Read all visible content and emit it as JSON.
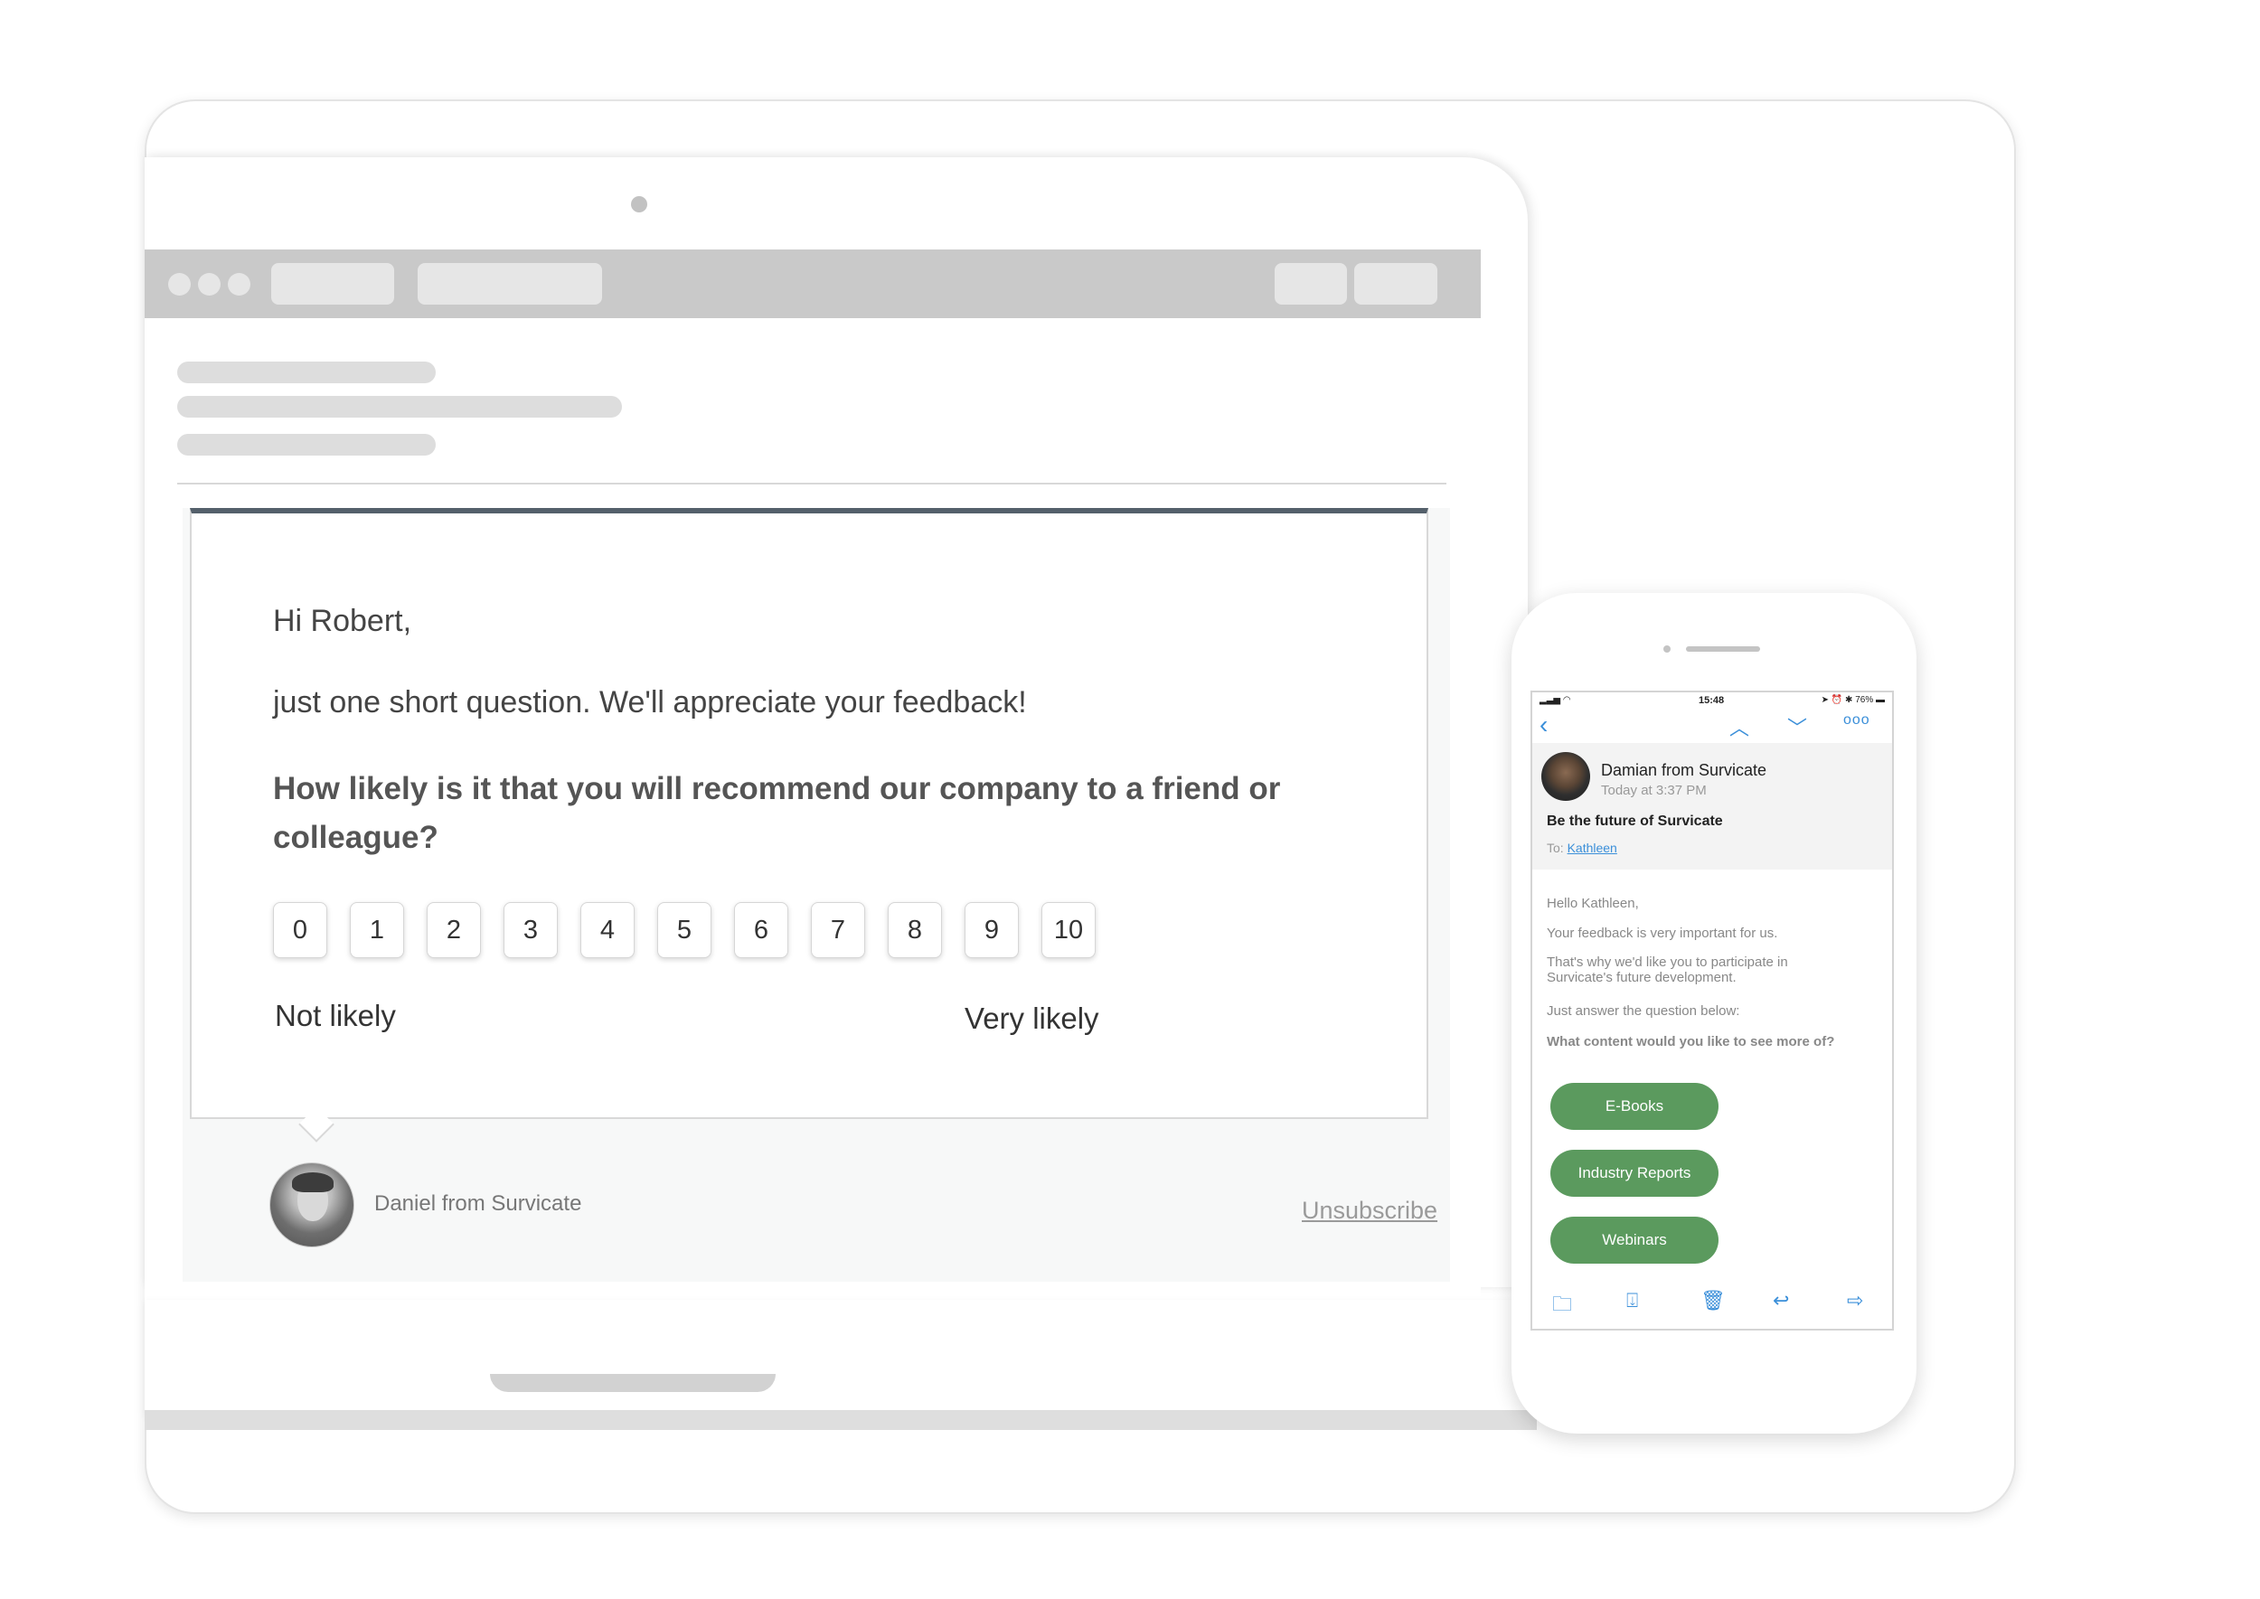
{
  "laptop": {
    "email": {
      "greeting": "Hi Robert,",
      "intro": "just one short question. We'll appreciate your feedback!",
      "question": "How likely is it that you will recommend our company to a friend or colleague?",
      "scores": [
        "0",
        "1",
        "2",
        "3",
        "4",
        "5",
        "6",
        "7",
        "8",
        "9",
        "10"
      ],
      "low_label": "Not likely",
      "high_label": "Very likely",
      "sender": "Daniel from Survicate",
      "unsubscribe": "Unsubscribe"
    }
  },
  "phone": {
    "status_time": "15:48",
    "status_battery": "76%",
    "from": "Damian from Survicate",
    "date": "Today at 3:37 PM",
    "subject": "Be the future of Survicate",
    "to_label": "To:",
    "to_name": "Kathleen",
    "body": {
      "hello": "Hello Kathleen,",
      "line1": "Your feedback is very important for us.",
      "line2": "That's why we'd like you to participate in Survicate's future development.",
      "line3": "Just answer the question below:"
    },
    "question": "What content would you like to see more of?",
    "options": [
      "E-Books",
      "Industry Reports",
      "Webinars"
    ],
    "icons": [
      "back-chevron",
      "up-arrow",
      "down-arrow",
      "more",
      "folder",
      "archive",
      "trash",
      "reply",
      "forward"
    ]
  },
  "colors": {
    "accent_blue": "#3b8fd9",
    "button_green": "#5b9a5e",
    "email_top_border": "#54606b"
  }
}
